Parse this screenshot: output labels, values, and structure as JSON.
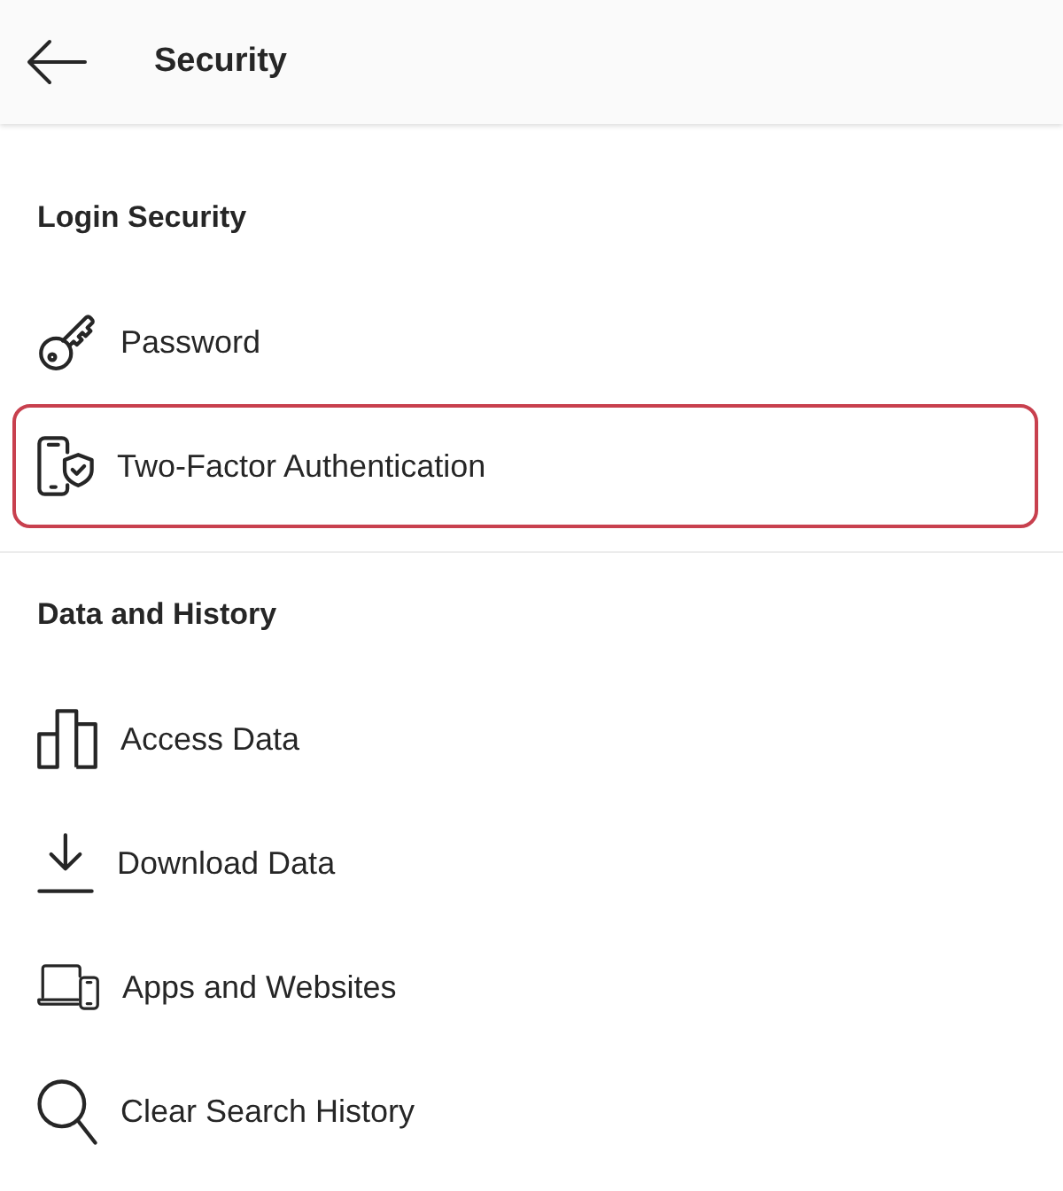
{
  "header": {
    "title": "Security"
  },
  "sections": [
    {
      "heading": "Login Security",
      "items": [
        {
          "label": "Password",
          "highlighted": false
        },
        {
          "label": "Two-Factor Authentication",
          "highlighted": true
        }
      ]
    },
    {
      "heading": "Data and History",
      "items": [
        {
          "label": "Access Data",
          "highlighted": false
        },
        {
          "label": "Download Data",
          "highlighted": false
        },
        {
          "label": "Apps and Websites",
          "highlighted": false
        },
        {
          "label": "Clear Search History",
          "highlighted": false
        }
      ]
    }
  ]
}
